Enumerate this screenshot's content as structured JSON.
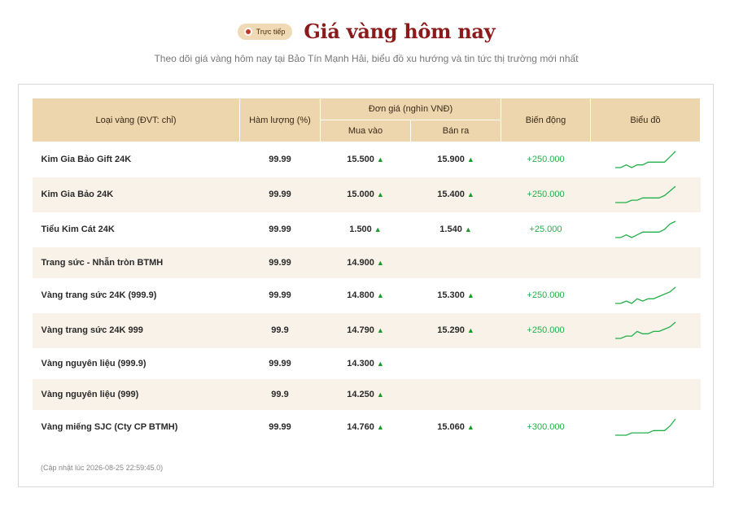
{
  "header": {
    "live_label": "Trực tiếp",
    "title": "Giá vàng hôm nay",
    "subtitle": "Theo dõi giá vàng hôm nay tại Bảo Tín Mạnh Hải, biểu đồ xu hướng và tin tức thị trường mới nhất"
  },
  "table": {
    "headers": {
      "type": "Loại vàng (ĐVT: chỉ)",
      "purity": "Hàm lượng (%)",
      "unit_price": "Đơn giá (nghìn VNĐ)",
      "buy": "Mua vào",
      "sell": "Bán ra",
      "change": "Biến động",
      "chart": "Biểu đồ"
    },
    "rows": [
      {
        "name": "Kim Gia Bảo Gift 24K",
        "purity": "99.99",
        "buy": "15.500",
        "sell": "15.900",
        "change": "+250.000",
        "trend": [
          1,
          1,
          2,
          1,
          2,
          2,
          3,
          3,
          3,
          3,
          5,
          7
        ]
      },
      {
        "name": "Kim Gia Bảo 24K",
        "purity": "99.99",
        "buy": "15.000",
        "sell": "15.400",
        "change": "+250.000",
        "trend": [
          1,
          1,
          1,
          2,
          2,
          3,
          3,
          3,
          3,
          4,
          6,
          8
        ]
      },
      {
        "name": "Tiểu Kim Cát 24K",
        "purity": "99.99",
        "buy": "1.500",
        "sell": "1.540",
        "change": "+25.000",
        "trend": [
          1,
          1,
          2,
          1,
          2,
          3,
          3,
          3,
          3,
          4,
          6,
          7
        ]
      },
      {
        "name": "Trang sức - Nhẫn tròn BTMH",
        "purity": "99.99",
        "buy": "14.900",
        "sell": "",
        "change": "",
        "trend": []
      },
      {
        "name": "Vàng trang sức 24K (999.9)",
        "purity": "99.99",
        "buy": "14.800",
        "sell": "15.300",
        "change": "+250.000",
        "trend": [
          1,
          1,
          2,
          1,
          3,
          2,
          3,
          3,
          4,
          5,
          6,
          8
        ]
      },
      {
        "name": "Vàng trang sức 24K 999",
        "purity": "99.9",
        "buy": "14.790",
        "sell": "15.290",
        "change": "+250.000",
        "trend": [
          1,
          1,
          2,
          2,
          4,
          3,
          3,
          4,
          4,
          5,
          6,
          8
        ]
      },
      {
        "name": "Vàng nguyên liệu (999.9)",
        "purity": "99.99",
        "buy": "14.300",
        "sell": "",
        "change": "",
        "trend": []
      },
      {
        "name": "Vàng nguyên liệu (999)",
        "purity": "99.9",
        "buy": "14.250",
        "sell": "",
        "change": "",
        "trend": []
      },
      {
        "name": "Vàng miếng SJC (Cty CP BTMH)",
        "purity": "99.99",
        "buy": "14.760",
        "sell": "15.060",
        "change": "+300.000",
        "trend": [
          1,
          1,
          1,
          2,
          2,
          2,
          2,
          3,
          3,
          3,
          5,
          8
        ]
      }
    ]
  },
  "footnote": "(Cập nhật lúc 2026-08-25 22:59:45.0)",
  "colors": {
    "accent": "#8b1a1a",
    "header_bg": "#edd5ae",
    "positive": "#22b04a",
    "row_alt": "#f8f2e8"
  },
  "icons": {
    "up_arrow": "▲",
    "live": "live-dot-icon"
  }
}
